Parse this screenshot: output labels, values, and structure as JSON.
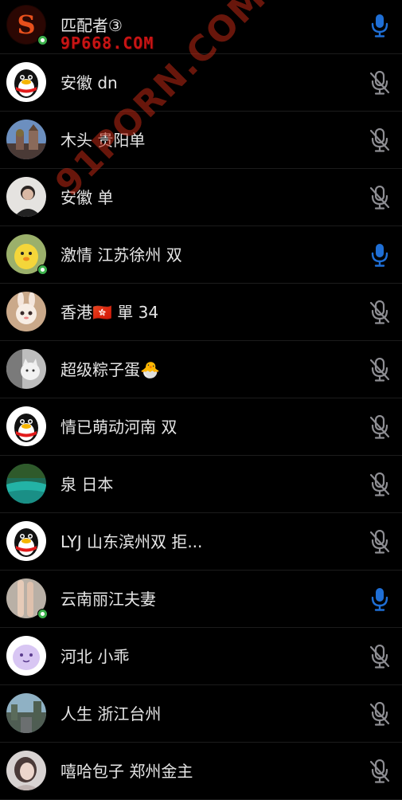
{
  "members": [
    {
      "name": "匹配者③",
      "avatar": "letter-s-avatar",
      "mic": "mic-on",
      "badge": true
    },
    {
      "name": "安徽 dn",
      "avatar": "penguin-avatar",
      "mic": "mic-off",
      "badge": false
    },
    {
      "name": "木头 贵阳单",
      "avatar": "building-avatar",
      "mic": "mic-off",
      "badge": false
    },
    {
      "name": "安徽 单",
      "avatar": "person-avatar",
      "mic": "mic-off",
      "badge": false
    },
    {
      "name": "激情 江苏徐州 双",
      "avatar": "duck-avatar",
      "mic": "mic-on",
      "badge": true
    },
    {
      "name": "香港🇭🇰 單 34",
      "avatar": "bunny-avatar",
      "mic": "mic-off",
      "badge": false
    },
    {
      "name": "超级粽子蛋🐣",
      "avatar": "cat-avatar",
      "mic": "mic-off",
      "badge": false
    },
    {
      "name": "情已萌动河南 双",
      "avatar": "penguin-avatar",
      "mic": "mic-off",
      "badge": false
    },
    {
      "name": "泉 日本",
      "avatar": "lake-avatar",
      "mic": "mic-off",
      "badge": false
    },
    {
      "name": "LYJ  山东滨州双 拒...",
      "avatar": "penguin-avatar",
      "mic": "mic-off",
      "badge": false
    },
    {
      "name": "云南丽江夫妻",
      "avatar": "legs-avatar",
      "mic": "mic-on",
      "badge": true
    },
    {
      "name": "河北 小乖",
      "avatar": "ghost-avatar",
      "mic": "mic-off",
      "badge": false
    },
    {
      "name": "人生 浙江台州",
      "avatar": "street-avatar",
      "mic": "mic-off",
      "badge": false
    },
    {
      "name": "嘻哈包子  郑州金主",
      "avatar": "girl-avatar",
      "mic": "mic-off",
      "badge": false
    }
  ],
  "watermarks": {
    "domain": "9P668.COM",
    "diagonal": "91PORN.COM"
  },
  "colors": {
    "background": "#000000",
    "mic_on": "#1f6fd6",
    "mic_off": "#8e8e93",
    "badge": "#3db14c",
    "watermark": "#c81414"
  }
}
